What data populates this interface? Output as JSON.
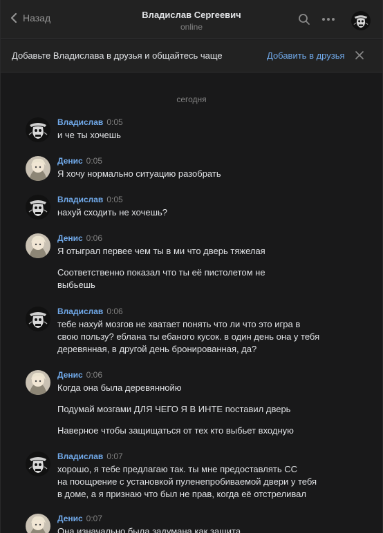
{
  "header": {
    "back_label": "Назад",
    "title": "Владислав Сергеевич",
    "status": "online"
  },
  "banner": {
    "text": "Добавьте Владислава в друзья и общайтесь чаще",
    "action": "Добавить в друзья"
  },
  "day_separator": "сегодня",
  "colors": {
    "accent": "#71aaeb",
    "background": "#19191a",
    "panel": "#222222"
  },
  "icons": [
    "chevron-left-icon",
    "search-icon",
    "more-icon",
    "close-icon"
  ],
  "messages": [
    {
      "author": "Владислав",
      "time": "0:05",
      "lines": [
        "и че ты хочешь"
      ]
    },
    {
      "author": "Денис",
      "time": "0:05",
      "lines": [
        "Я хочу нормально ситуацию разобрать"
      ]
    },
    {
      "author": "Владислав",
      "time": "0:05",
      "lines": [
        "нахуй сходить не хочешь?"
      ]
    },
    {
      "author": "Денис",
      "time": "0:06",
      "lines": [
        "Я отыграл первее чем ты в ми что дверь тяжелая",
        "Соответственно показал что ты её пистолетом не",
        "выбьешь"
      ]
    },
    {
      "author": "Владислав",
      "time": "0:06",
      "lines": [
        "тебе нахуй мозгов не хватает понять что ли что это игра в",
        "свою пользу? еблана ты ебаного кусок. в один день она у тебя",
        "деревянная, в другой день бронированная, да?"
      ]
    },
    {
      "author": "Денис",
      "time": "0:06",
      "lines": [
        "Когда она была деревяннойю",
        "Подумай мозгами ДЛЯ ЧЕГО Я В ИНТЕ поставил дверь",
        "Наверное чтобы защищаться от тех кто выбьет входную"
      ]
    },
    {
      "author": "Владислав",
      "time": "0:07",
      "lines": [
        "хорошо, я тебе предлагаю так. ты мне предоставлять СС",
        "на поощрение с установкой пуленепробиваемой двери у тебя",
        "в доме, а я признаю что был не прав, когда её отстреливал"
      ]
    },
    {
      "author": "Денис",
      "time": "0:07",
      "lines": [
        "Она изначально была задумана как защита"
      ]
    }
  ]
}
